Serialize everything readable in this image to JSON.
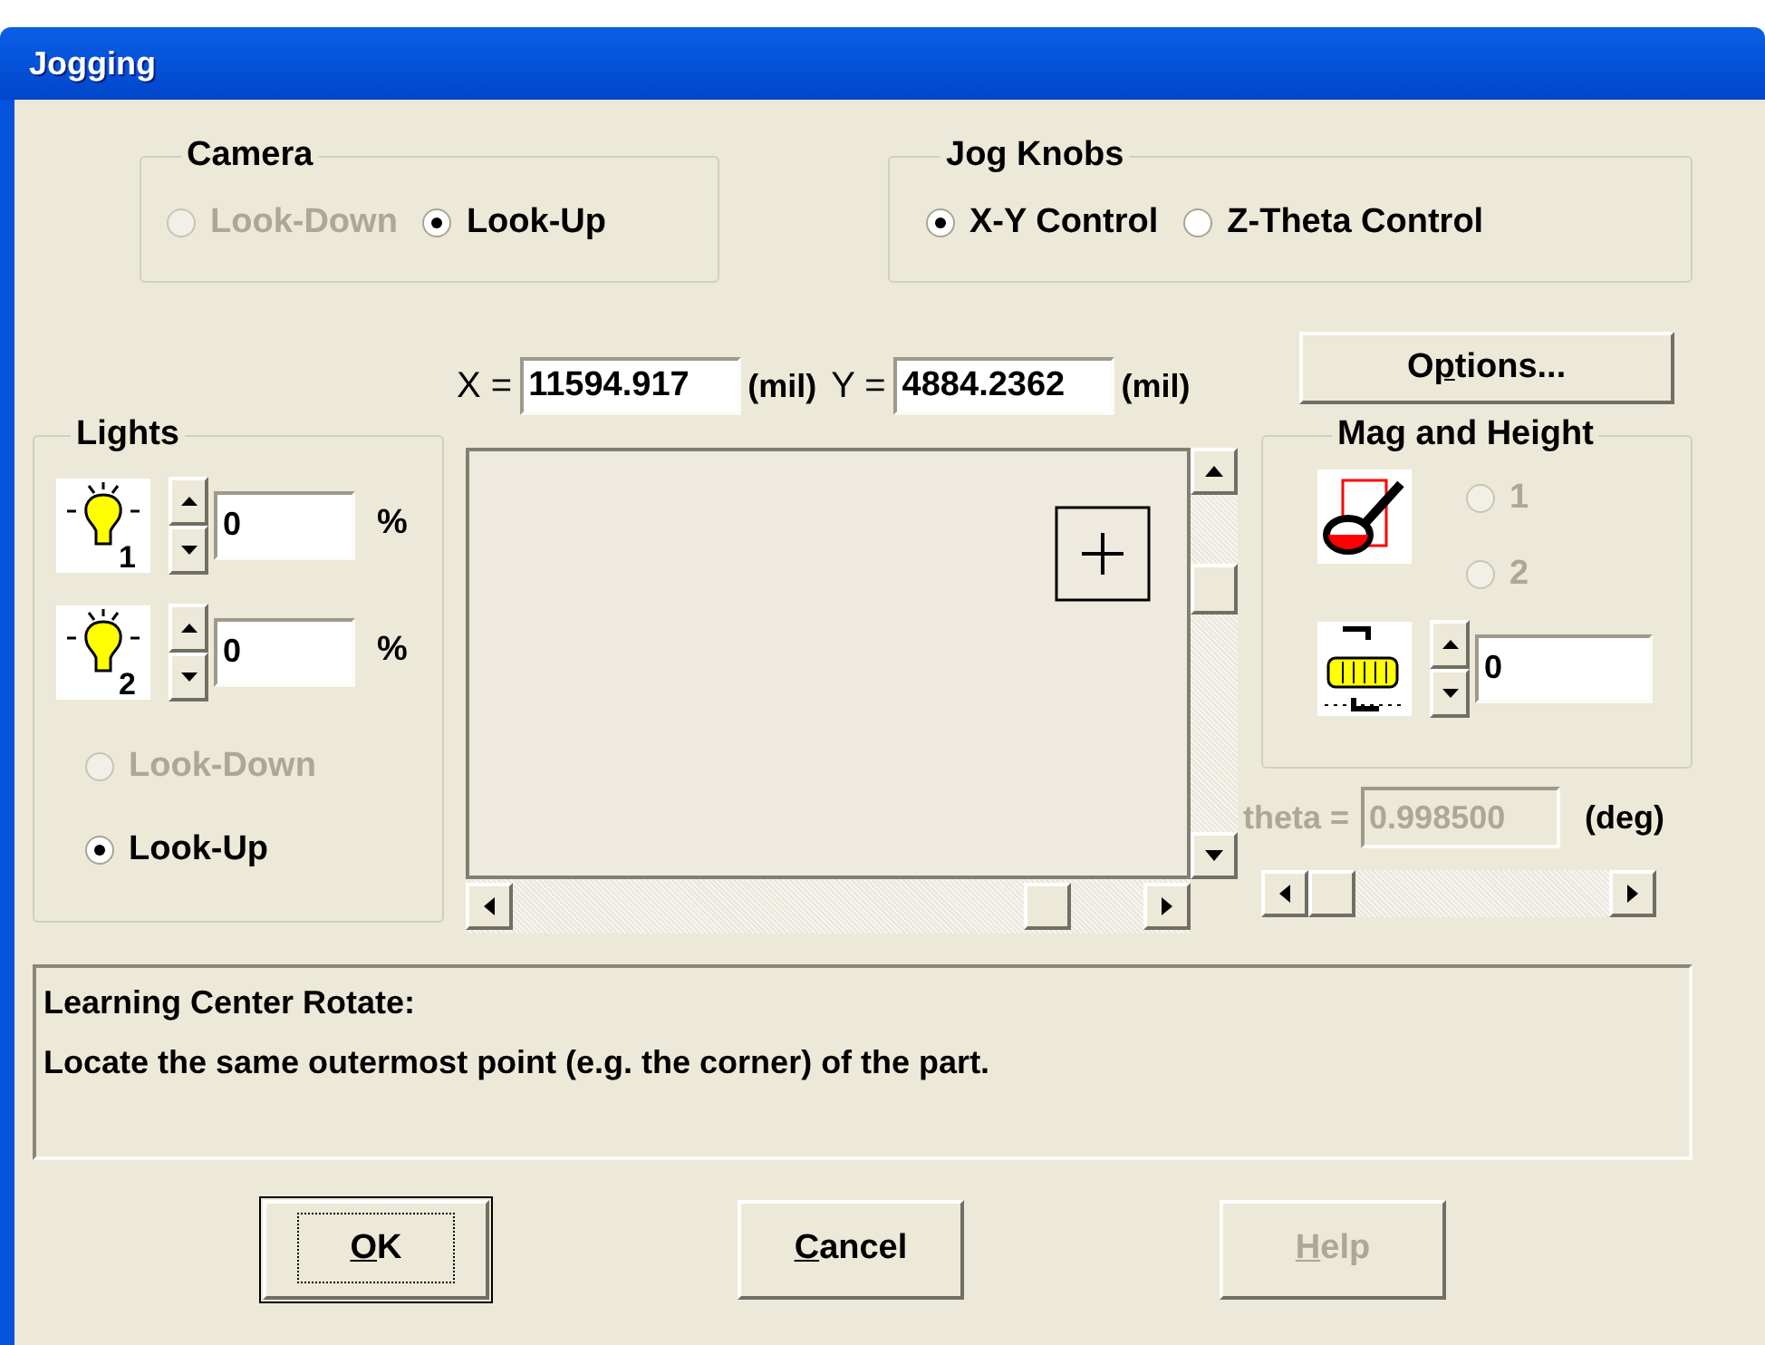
{
  "window": {
    "title": "Jogging"
  },
  "camera": {
    "title": "Camera",
    "options": [
      {
        "label": "Look-Down",
        "selected": false,
        "disabled": true
      },
      {
        "label": "Look-Up",
        "selected": true,
        "disabled": false
      }
    ]
  },
  "jog_knobs": {
    "title": "Jog Knobs",
    "options": [
      {
        "label": "X-Y Control",
        "selected": true,
        "disabled": false
      },
      {
        "label": "Z-Theta Control",
        "selected": false,
        "disabled": false
      }
    ]
  },
  "position": [
    {
      "label": "X =",
      "value": "11594.917",
      "unit": "(mil)"
    },
    {
      "label": "Y =",
      "value": "4884.2362",
      "unit": "(mil)"
    }
  ],
  "options_button": {
    "label_parts": [
      {
        "text": "O",
        "underlined": false
      },
      {
        "text": "p",
        "underlined": true
      },
      {
        "text": "tions...",
        "underlined": false
      }
    ],
    "disabled": false
  },
  "lights": {
    "title": "Lights",
    "channels": [
      {
        "number": "1",
        "value": "0",
        "unit": "%"
      },
      {
        "number": "2",
        "value": "0",
        "unit": "%"
      }
    ],
    "options": [
      {
        "label": "Look-Down",
        "selected": false,
        "disabled": true
      },
      {
        "label": "Look-Up",
        "selected": true,
        "disabled": false
      }
    ]
  },
  "mag_and_height": {
    "title": "Mag and Height",
    "options": [
      {
        "label": "1",
        "selected": false,
        "disabled": true
      },
      {
        "label": "2",
        "selected": false,
        "disabled": true
      }
    ],
    "height": {
      "value": "0"
    }
  },
  "theta": {
    "label": "theta =",
    "value": "0.998500",
    "unit": "(deg)",
    "disabled": true
  },
  "message": {
    "lines": [
      "Learning Center Rotate:",
      "Locate the same outermost point (e.g. the corner) of the part."
    ]
  },
  "buttons": [
    {
      "label_parts": [
        {
          "text": "O",
          "underlined": true
        },
        {
          "text": "K",
          "underlined": false
        }
      ],
      "default": true,
      "disabled": false
    },
    {
      "label_parts": [
        {
          "text": "C",
          "underlined": true
        },
        {
          "text": "ancel",
          "underlined": false
        }
      ],
      "default": false,
      "disabled": false
    },
    {
      "label_parts": [
        {
          "text": "H",
          "underlined": true
        },
        {
          "text": "elp",
          "underlined": false
        }
      ],
      "default": false,
      "disabled": true
    }
  ]
}
